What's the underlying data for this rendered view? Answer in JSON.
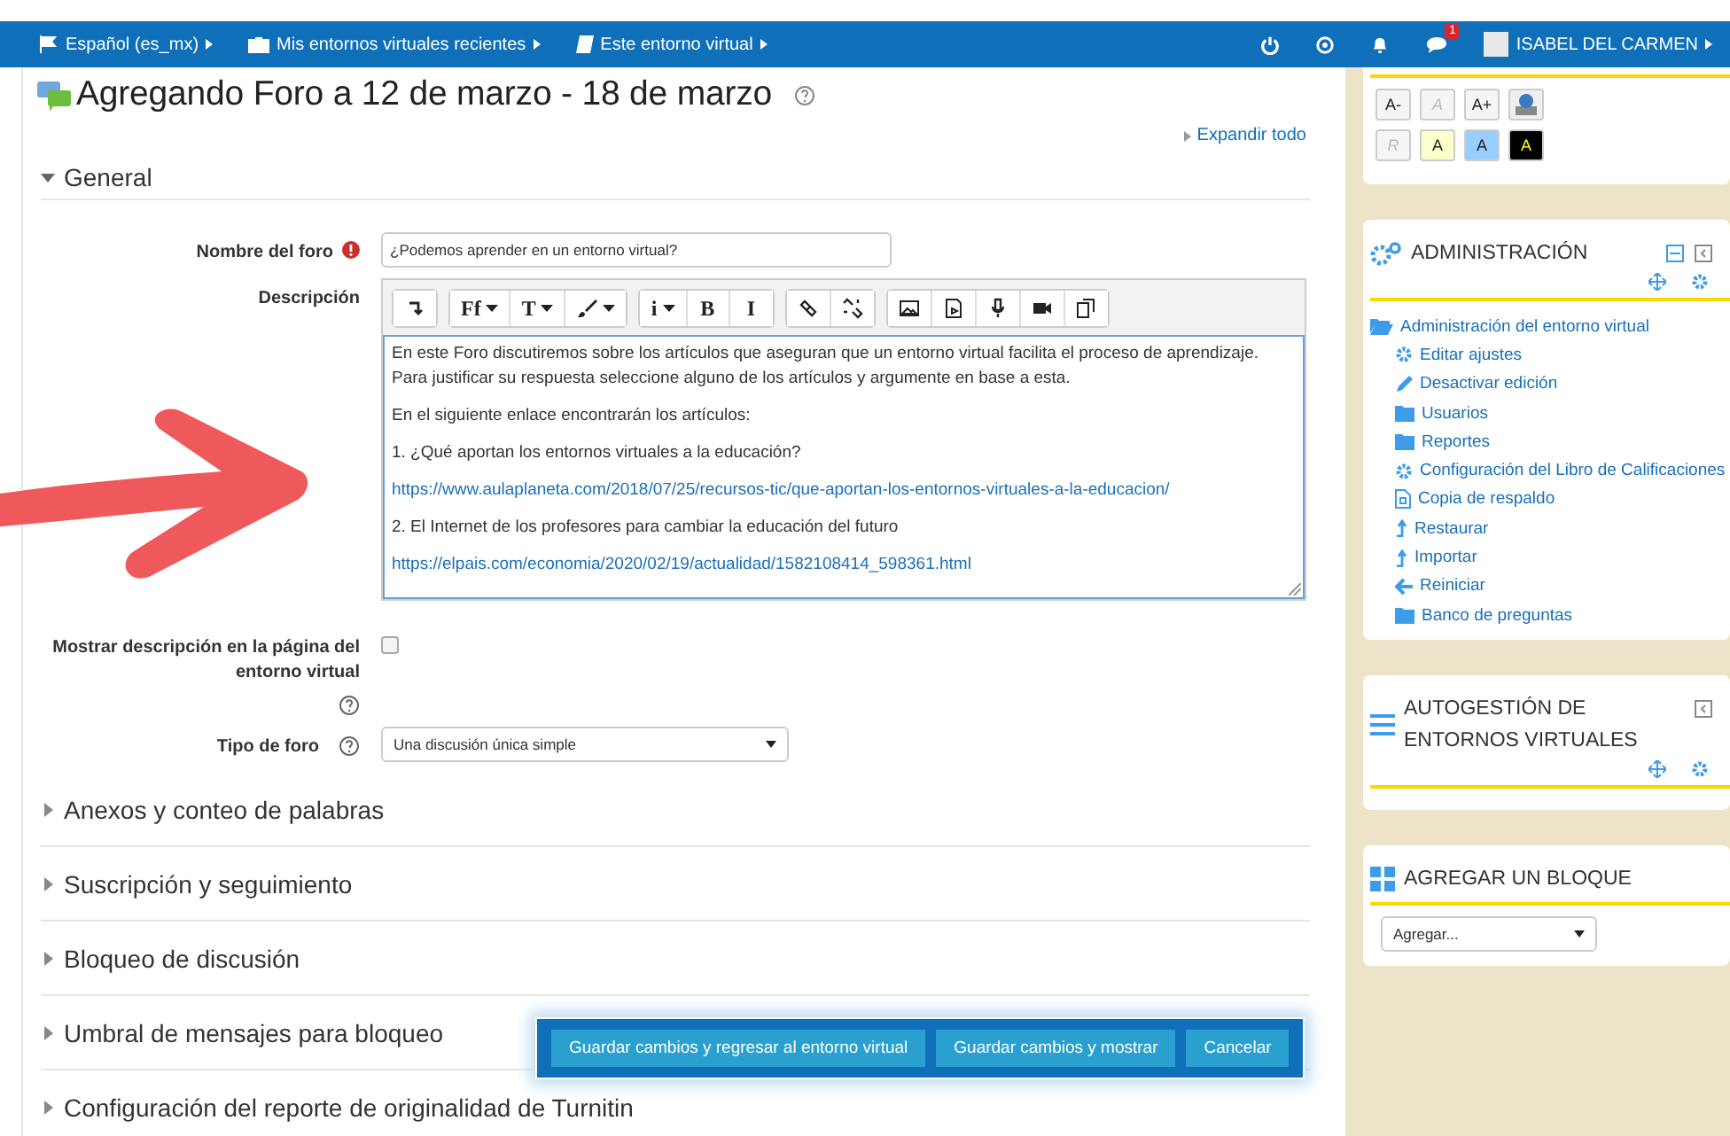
{
  "navbar": {
    "items": [
      {
        "kind": "flag",
        "label": "Español (es_mx)"
      },
      {
        "kind": "briefcase",
        "label": "Mis entornos virtuales recientes"
      },
      {
        "kind": "book",
        "label": "Este entorno virtual"
      }
    ],
    "message_count": "1",
    "user_name": "ISABEL DEL CARMEN"
  },
  "page_title": "Agregando Foro a 12 de marzo - 18 de marzo",
  "expand_all": "Expandir todo",
  "general": {
    "title": "General",
    "expanded": true,
    "forum_name": {
      "label": "Nombre del foro",
      "value": "¿Podemos aprender en un entorno virtual?"
    },
    "description": {
      "label": "Descripción",
      "toolbar": [
        [
          {
            "kind": "collapse"
          }
        ],
        [
          {
            "kind": "text",
            "label": "Ff",
            "dropdown": true
          },
          {
            "kind": "text",
            "label": "T",
            "dropdown": true
          },
          {
            "kind": "brush",
            "dropdown": true
          }
        ],
        [
          {
            "kind": "text",
            "label": "i",
            "dropdown": true
          },
          {
            "kind": "text",
            "label": "B",
            "dropdown": false
          },
          {
            "kind": "text",
            "label": "I",
            "dropdown": false
          }
        ],
        [
          {
            "kind": "link"
          },
          {
            "kind": "unlink"
          }
        ],
        [
          {
            "kind": "image"
          },
          {
            "kind": "media"
          },
          {
            "kind": "mic"
          },
          {
            "kind": "video"
          },
          {
            "kind": "copy"
          }
        ]
      ],
      "paragraphs": [
        {
          "kind": "text",
          "text": "En este Foro discutiremos sobre los artículos que aseguran que un entorno virtual facilita el proceso de aprendizaje. Para justificar su respuesta seleccione alguno de los artículos y argumente en base a esta."
        },
        {
          "kind": "text",
          "text": "En el siguiente enlace encontrarán los artículos:"
        },
        {
          "kind": "text",
          "text": "1. ¿Qué aportan los entornos virtuales a la educación?"
        },
        {
          "kind": "link",
          "text": "https://www.aulaplaneta.com/2018/07/25/recursos-tic/que-aportan-los-entornos-virtuales-a-la-educacion/"
        },
        {
          "kind": "text",
          "text": "2. El Internet de los profesores para cambiar la educación del futuro"
        },
        {
          "kind": "link",
          "text": "https://elpais.com/economia/2020/02/19/actualidad/1582108414_598361.html"
        }
      ]
    },
    "show_description": {
      "label": "Mostrar descripción en la página del entorno virtual",
      "checked": false
    },
    "forum_type": {
      "label": "Tipo de foro",
      "value": "Una discusión única simple"
    }
  },
  "sections": [
    {
      "title": "Anexos y conteo de palabras",
      "expanded": false
    },
    {
      "title": "Suscripción y seguimiento",
      "expanded": false
    },
    {
      "title": "Bloqueo de discusión",
      "expanded": false
    },
    {
      "title": "Umbral de mensajes para bloqueo",
      "expanded": false
    },
    {
      "title": "Configuración del reporte de originalidad de Turnitin",
      "expanded": false
    }
  ],
  "buttons": [
    "Guardar cambios y regresar al entorno virtual",
    "Guardar cambios y mostrar",
    "Cancelar"
  ],
  "accessibility": {
    "rows": [
      [
        {
          "label": "A-",
          "disabled": false,
          "color": "#f5f5f5"
        },
        {
          "label": "A",
          "disabled": true,
          "color": "#f5f5f5"
        },
        {
          "label": "A+",
          "disabled": false,
          "color": "#f5f5f5"
        }
      ],
      [
        {
          "label": "R",
          "disabled": true,
          "color": "#f5f5f5"
        },
        {
          "label": "A",
          "disabled": false,
          "color": "#ffffcc"
        },
        {
          "label": "A",
          "disabled": false,
          "color": "#99ccff"
        },
        {
          "label": "A",
          "disabled": false,
          "color": "#000000"
        }
      ]
    ]
  },
  "administration": {
    "title": "ADMINISTRACIÓN",
    "items": [
      {
        "kind": "folder-open",
        "label": "Administración del entorno virtual",
        "children": [
          {
            "kind": "gear",
            "label": "Editar ajustes"
          },
          {
            "kind": "pencil",
            "label": "Desactivar edición"
          },
          {
            "kind": "folder",
            "label": "Usuarios"
          },
          {
            "kind": "folder",
            "label": "Reportes"
          },
          {
            "kind": "gear",
            "label": "Configuración del Libro de Calificaciones"
          },
          {
            "kind": "file",
            "label": "Copia de respaldo"
          },
          {
            "kind": "upload",
            "label": "Restaurar"
          },
          {
            "kind": "upload",
            "label": "Importar"
          },
          {
            "kind": "back",
            "label": "Reiniciar"
          },
          {
            "kind": "folder",
            "label": "Banco de preguntas"
          }
        ]
      }
    ]
  },
  "self_management": {
    "title": "AUTOGESTIÓN DE ENTORNOS VIRTUALES"
  },
  "add_block": {
    "title": "AGREGAR UN BLOQUE",
    "placeholder": "Agregar..."
  }
}
